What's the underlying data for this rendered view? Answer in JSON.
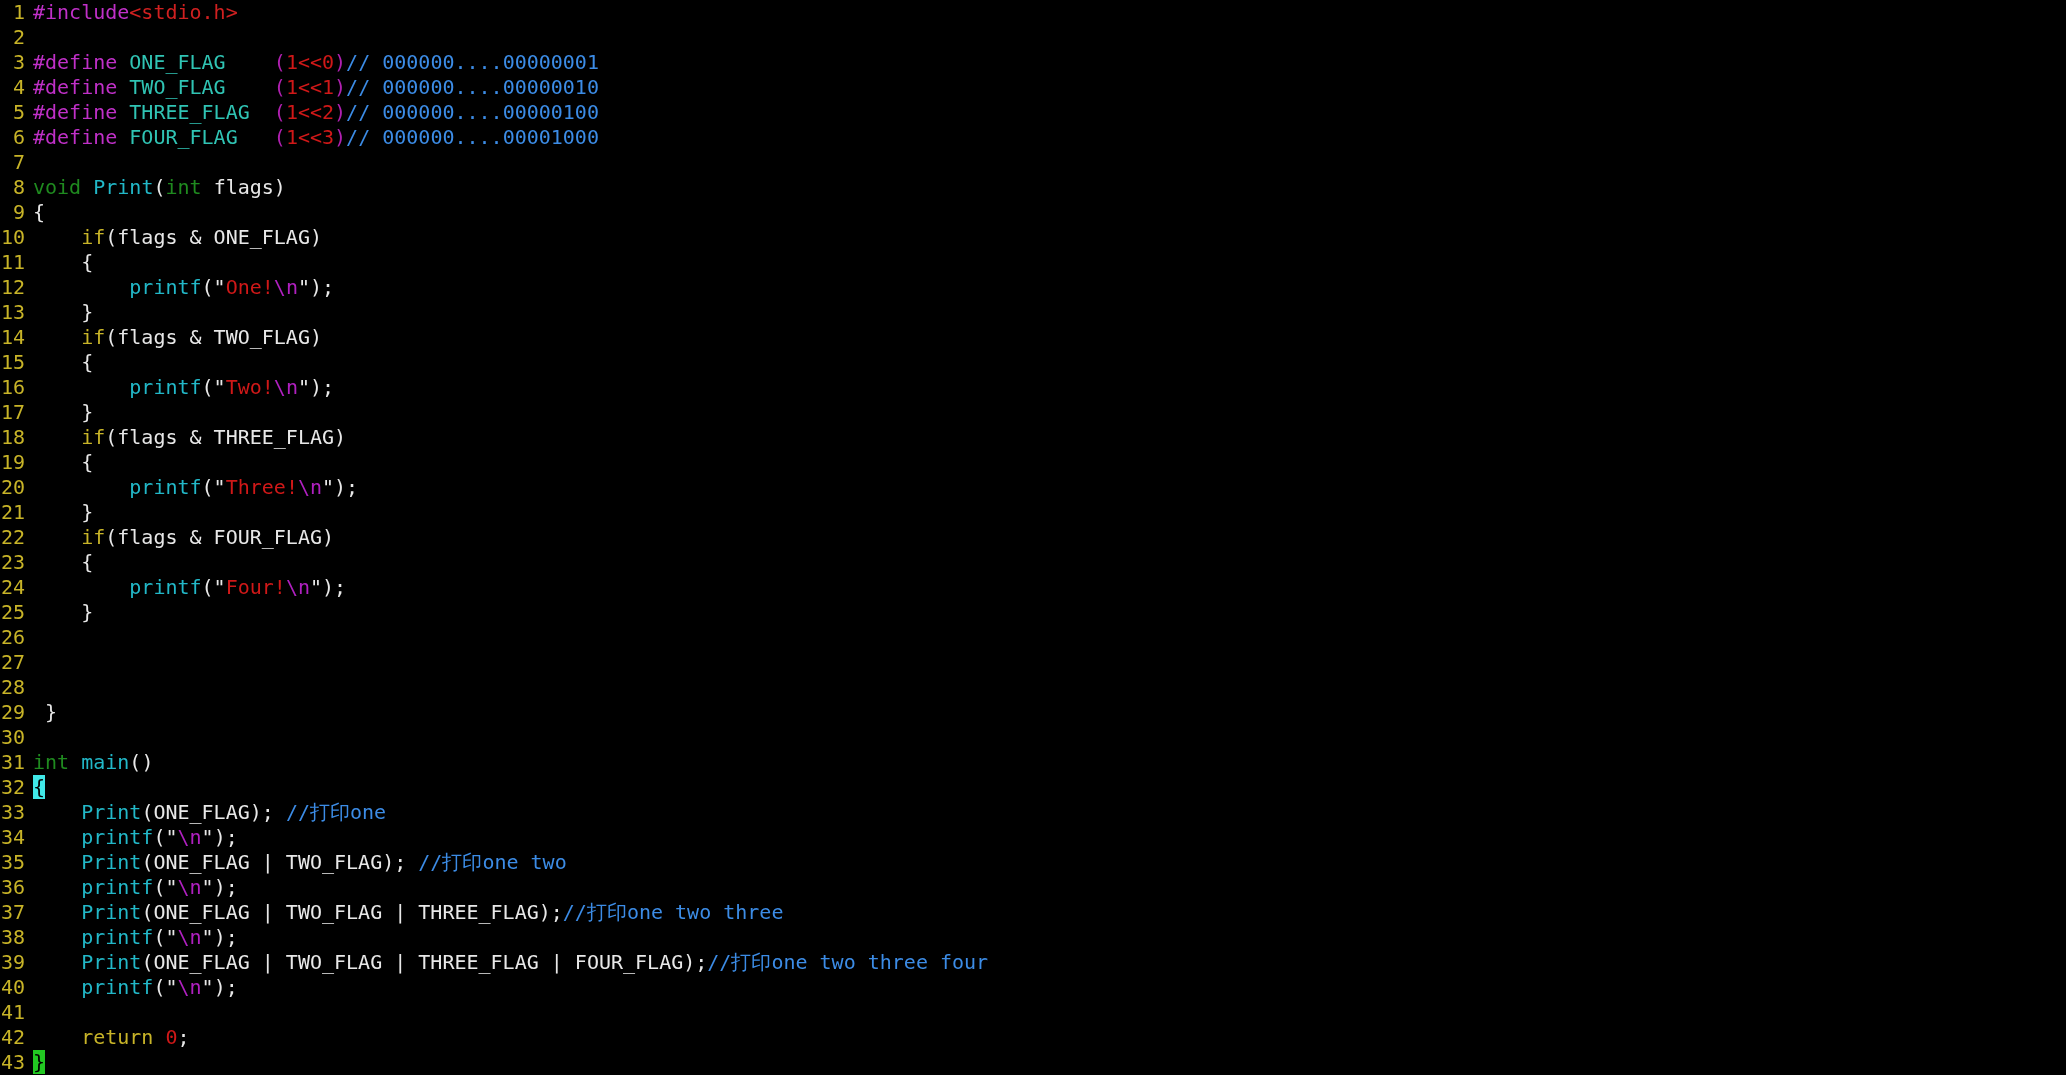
{
  "editor": {
    "lines": [
      {
        "number": "1",
        "tokens": [
          {
            "kind": "pre",
            "text": "#include"
          },
          {
            "kind": "path",
            "text": "<stdio.h>"
          }
        ]
      },
      {
        "number": "2"
      },
      {
        "number": "3",
        "tokens": [
          {
            "kind": "pre",
            "text": "#define "
          },
          {
            "kind": "macro",
            "text": "ONE_FLAG    "
          },
          {
            "kind": "delim",
            "text": "("
          },
          {
            "kind": "num",
            "text": "1<<0"
          },
          {
            "kind": "delim",
            "text": ")"
          },
          {
            "kind": "comment",
            "text": "// 000000....00000001"
          }
        ]
      },
      {
        "number": "4",
        "tokens": [
          {
            "kind": "pre",
            "text": "#define "
          },
          {
            "kind": "macro",
            "text": "TWO_FLAG    "
          },
          {
            "kind": "delim",
            "text": "("
          },
          {
            "kind": "num",
            "text": "1<<1"
          },
          {
            "kind": "delim",
            "text": ")"
          },
          {
            "kind": "comment",
            "text": "// 000000....00000010"
          }
        ]
      },
      {
        "number": "5",
        "tokens": [
          {
            "kind": "pre",
            "text": "#define "
          },
          {
            "kind": "macro",
            "text": "THREE_FLAG  "
          },
          {
            "kind": "delim",
            "text": "("
          },
          {
            "kind": "num",
            "text": "1<<2"
          },
          {
            "kind": "delim",
            "text": ")"
          },
          {
            "kind": "comment",
            "text": "// 000000....00000100"
          }
        ]
      },
      {
        "number": "6",
        "tokens": [
          {
            "kind": "pre",
            "text": "#define "
          },
          {
            "kind": "macro",
            "text": "FOUR_FLAG   "
          },
          {
            "kind": "delim",
            "text": "("
          },
          {
            "kind": "num",
            "text": "1<<3"
          },
          {
            "kind": "delim",
            "text": ")"
          },
          {
            "kind": "comment",
            "text": "// 000000....00001000"
          }
        ]
      },
      {
        "number": "7"
      },
      {
        "number": "8",
        "tokens": [
          {
            "kind": "type",
            "text": "void "
          },
          {
            "kind": "func",
            "text": "Print"
          },
          {
            "kind": "plain",
            "text": "("
          },
          {
            "kind": "type",
            "text": "int"
          },
          {
            "kind": "plain",
            "text": " flags)"
          }
        ]
      },
      {
        "number": "9",
        "tokens": [
          {
            "kind": "plain",
            "text": "{"
          }
        ]
      },
      {
        "number": "10",
        "tokens": [
          {
            "kind": "kw",
            "text": "    if"
          },
          {
            "kind": "plain",
            "text": "(flags & ONE_FLAG)"
          }
        ]
      },
      {
        "number": "11",
        "tokens": [
          {
            "kind": "plain",
            "text": "    {"
          }
        ]
      },
      {
        "number": "12",
        "tokens": [
          {
            "kind": "func",
            "text": "        printf"
          },
          {
            "kind": "plain",
            "text": "(\""
          },
          {
            "kind": "str",
            "text": "One!"
          },
          {
            "kind": "esc",
            "text": "\\n"
          },
          {
            "kind": "plain",
            "text": "\");"
          }
        ]
      },
      {
        "number": "13",
        "tokens": [
          {
            "kind": "plain",
            "text": "    }"
          }
        ]
      },
      {
        "number": "14",
        "tokens": [
          {
            "kind": "kw",
            "text": "    if"
          },
          {
            "kind": "plain",
            "text": "(flags & TWO_FLAG)"
          }
        ]
      },
      {
        "number": "15",
        "tokens": [
          {
            "kind": "plain",
            "text": "    {"
          }
        ]
      },
      {
        "number": "16",
        "tokens": [
          {
            "kind": "func",
            "text": "        printf"
          },
          {
            "kind": "plain",
            "text": "(\""
          },
          {
            "kind": "str",
            "text": "Two!"
          },
          {
            "kind": "esc",
            "text": "\\n"
          },
          {
            "kind": "plain",
            "text": "\");"
          }
        ]
      },
      {
        "number": "17",
        "tokens": [
          {
            "kind": "plain",
            "text": "    }"
          }
        ]
      },
      {
        "number": "18",
        "tokens": [
          {
            "kind": "kw",
            "text": "    if"
          },
          {
            "kind": "plain",
            "text": "(flags & THREE_FLAG)"
          }
        ]
      },
      {
        "number": "19",
        "tokens": [
          {
            "kind": "plain",
            "text": "    {"
          }
        ]
      },
      {
        "number": "20",
        "tokens": [
          {
            "kind": "func",
            "text": "        printf"
          },
          {
            "kind": "plain",
            "text": "(\""
          },
          {
            "kind": "str",
            "text": "Three!"
          },
          {
            "kind": "esc",
            "text": "\\n"
          },
          {
            "kind": "plain",
            "text": "\");"
          }
        ]
      },
      {
        "number": "21",
        "tokens": [
          {
            "kind": "plain",
            "text": "    }"
          }
        ]
      },
      {
        "number": "22",
        "tokens": [
          {
            "kind": "kw",
            "text": "    if"
          },
          {
            "kind": "plain",
            "text": "(flags & FOUR_FLAG)"
          }
        ]
      },
      {
        "number": "23",
        "tokens": [
          {
            "kind": "plain",
            "text": "    {"
          }
        ]
      },
      {
        "number": "24",
        "tokens": [
          {
            "kind": "func",
            "text": "        printf"
          },
          {
            "kind": "plain",
            "text": "(\""
          },
          {
            "kind": "str",
            "text": "Four!"
          },
          {
            "kind": "esc",
            "text": "\\n"
          },
          {
            "kind": "plain",
            "text": "\");"
          }
        ]
      },
      {
        "number": "25",
        "tokens": [
          {
            "kind": "plain",
            "text": "    }"
          }
        ]
      },
      {
        "number": "26"
      },
      {
        "number": "27"
      },
      {
        "number": "28"
      },
      {
        "number": "29",
        "tokens": [
          {
            "kind": "plain",
            "text": " }"
          }
        ]
      },
      {
        "number": "30"
      },
      {
        "number": "31",
        "tokens": [
          {
            "kind": "type",
            "text": "int "
          },
          {
            "kind": "func",
            "text": "main"
          },
          {
            "kind": "plain",
            "text": "()"
          }
        ]
      },
      {
        "number": "32",
        "tokens": [
          {
            "kind": "cursor",
            "text": "{"
          }
        ]
      },
      {
        "number": "33",
        "tokens": [
          {
            "kind": "func",
            "text": "    Print"
          },
          {
            "kind": "plain",
            "text": "(ONE_FLAG); "
          },
          {
            "kind": "comment",
            "text": "//打印one"
          }
        ]
      },
      {
        "number": "34",
        "tokens": [
          {
            "kind": "func",
            "text": "    printf"
          },
          {
            "kind": "plain",
            "text": "(\""
          },
          {
            "kind": "esc",
            "text": "\\n"
          },
          {
            "kind": "plain",
            "text": "\");"
          }
        ]
      },
      {
        "number": "35",
        "tokens": [
          {
            "kind": "func",
            "text": "    Print"
          },
          {
            "kind": "plain",
            "text": "(ONE_FLAG | TWO_FLAG); "
          },
          {
            "kind": "comment",
            "text": "//打印one two"
          }
        ]
      },
      {
        "number": "36",
        "tokens": [
          {
            "kind": "func",
            "text": "    printf"
          },
          {
            "kind": "plain",
            "text": "(\""
          },
          {
            "kind": "esc",
            "text": "\\n"
          },
          {
            "kind": "plain",
            "text": "\");"
          }
        ]
      },
      {
        "number": "37",
        "tokens": [
          {
            "kind": "func",
            "text": "    Print"
          },
          {
            "kind": "plain",
            "text": "(ONE_FLAG | TWO_FLAG | THREE_FLAG);"
          },
          {
            "kind": "comment",
            "text": "//打印one two three"
          }
        ]
      },
      {
        "number": "38",
        "tokens": [
          {
            "kind": "func",
            "text": "    printf"
          },
          {
            "kind": "plain",
            "text": "(\""
          },
          {
            "kind": "esc",
            "text": "\\n"
          },
          {
            "kind": "plain",
            "text": "\");"
          }
        ]
      },
      {
        "number": "39",
        "tokens": [
          {
            "kind": "func",
            "text": "    Print"
          },
          {
            "kind": "plain",
            "text": "(ONE_FLAG | TWO_FLAG | THREE_FLAG | FOUR_FLAG);"
          },
          {
            "kind": "comment",
            "text": "//打印one two three four"
          }
        ]
      },
      {
        "number": "40",
        "tokens": [
          {
            "kind": "func",
            "text": "    printf"
          },
          {
            "kind": "plain",
            "text": "(\""
          },
          {
            "kind": "esc",
            "text": "\\n"
          },
          {
            "kind": "plain",
            "text": "\");"
          }
        ]
      },
      {
        "number": "41"
      },
      {
        "number": "42",
        "tokens": [
          {
            "kind": "kw",
            "text": "    return "
          },
          {
            "kind": "num",
            "text": "0"
          },
          {
            "kind": "plain",
            "text": ";"
          }
        ]
      },
      {
        "number": "43",
        "tokens": [
          {
            "kind": "match",
            "text": "}"
          }
        ]
      }
    ]
  }
}
